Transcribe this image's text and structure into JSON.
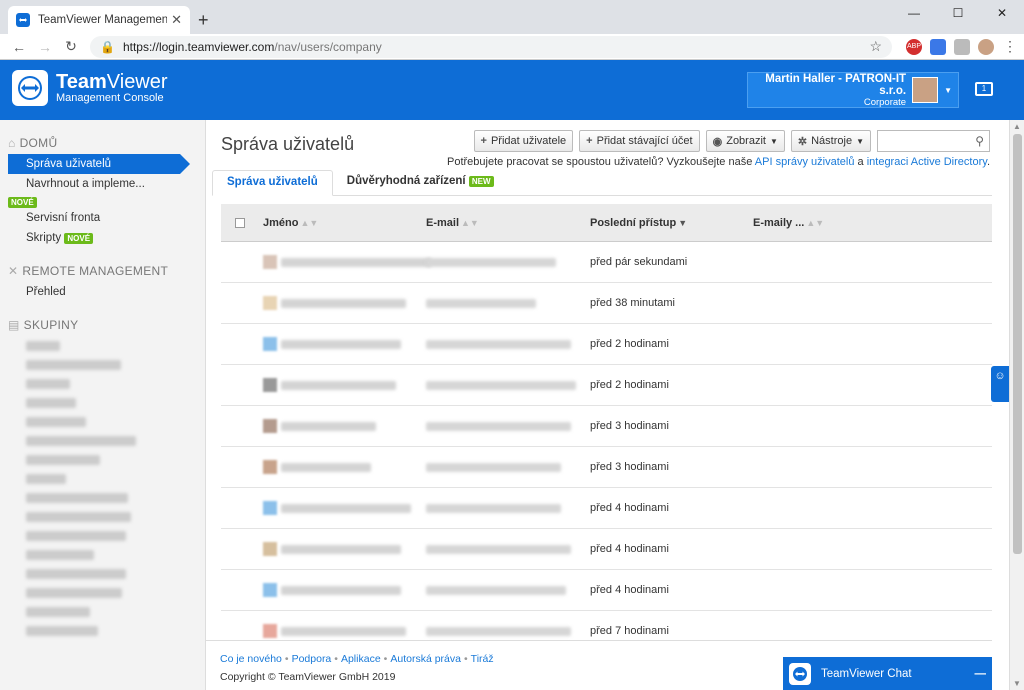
{
  "browser": {
    "tab_title": "TeamViewer Management Console",
    "tab_close": "✕",
    "new_tab": "+",
    "url_host": "https://login.teamviewer.com",
    "url_path": "/nav/users/company",
    "win_min": "—",
    "win_max": "☐",
    "win_close": "✕"
  },
  "header": {
    "brand_bold": "Team",
    "brand_light": "Viewer",
    "brand_sub": "Management Console",
    "user_name": "Martin Haller - PATRON-IT s.r.o.",
    "user_sub": "Corporate",
    "chat_count": "1"
  },
  "sidebar": {
    "home_label": "DOMŮ",
    "items": [
      {
        "label": "Správa uživatelů"
      },
      {
        "label": "Navrhnout a impleme..."
      },
      {
        "label": "Servisní fronta"
      },
      {
        "label": "Skripty"
      }
    ],
    "new_badge": "NOVÉ",
    "remote_label": "REMOTE MANAGEMENT",
    "overview_label": "Přehled",
    "groups_label": "SKUPINY"
  },
  "main": {
    "title": "Správa uživatelů",
    "buttons": {
      "add_user": "Přidat uživatele",
      "add_existing": "Přidat stávající účet",
      "view": "Zobrazit",
      "tools": "Nástroje"
    },
    "hint_text": "Potřebujete pracovat se spoustou uživatelů? Vyzkoušejte naše",
    "hint_link1": "API správy uživatelů",
    "hint_and": "a",
    "hint_link2": "integraci Active Directory",
    "hint_end": ".",
    "tabs": [
      "Správa uživatelů",
      "Důvěryhodná zařízení"
    ],
    "new_badge": "NEW",
    "columns": [
      "Jméno",
      "E-mail",
      "Poslední přístup",
      "E-maily ..."
    ],
    "rows": [
      {
        "last": "před pár sekundami",
        "color": "#d9c4b7"
      },
      {
        "last": "před 38 minutami",
        "color": "#e8d4b4"
      },
      {
        "last": "před 2 hodinami",
        "color": "#8cc0ea"
      },
      {
        "last": "před 2 hodinami",
        "color": "#999999"
      },
      {
        "last": "před 3 hodinami",
        "color": "#b49b8e"
      },
      {
        "last": "před 3 hodinami",
        "color": "#c8a38c"
      },
      {
        "last": "před 4 hodinami",
        "color": "#8cc0ea"
      },
      {
        "last": "před 4 hodinami",
        "color": "#d6bf9e"
      },
      {
        "last": "před 4 hodinami",
        "color": "#8cc0ea"
      },
      {
        "last": "před 7 hodinami",
        "color": "#e7a79c"
      }
    ]
  },
  "footer": {
    "links": [
      "Co je nového",
      "Podpora",
      "Aplikace",
      "Autorská práva",
      "Tiráž"
    ],
    "copyright": "Copyright © TeamViewer GmbH 2019"
  },
  "chat": {
    "label": "TeamViewer Chat",
    "minimize": "—"
  }
}
